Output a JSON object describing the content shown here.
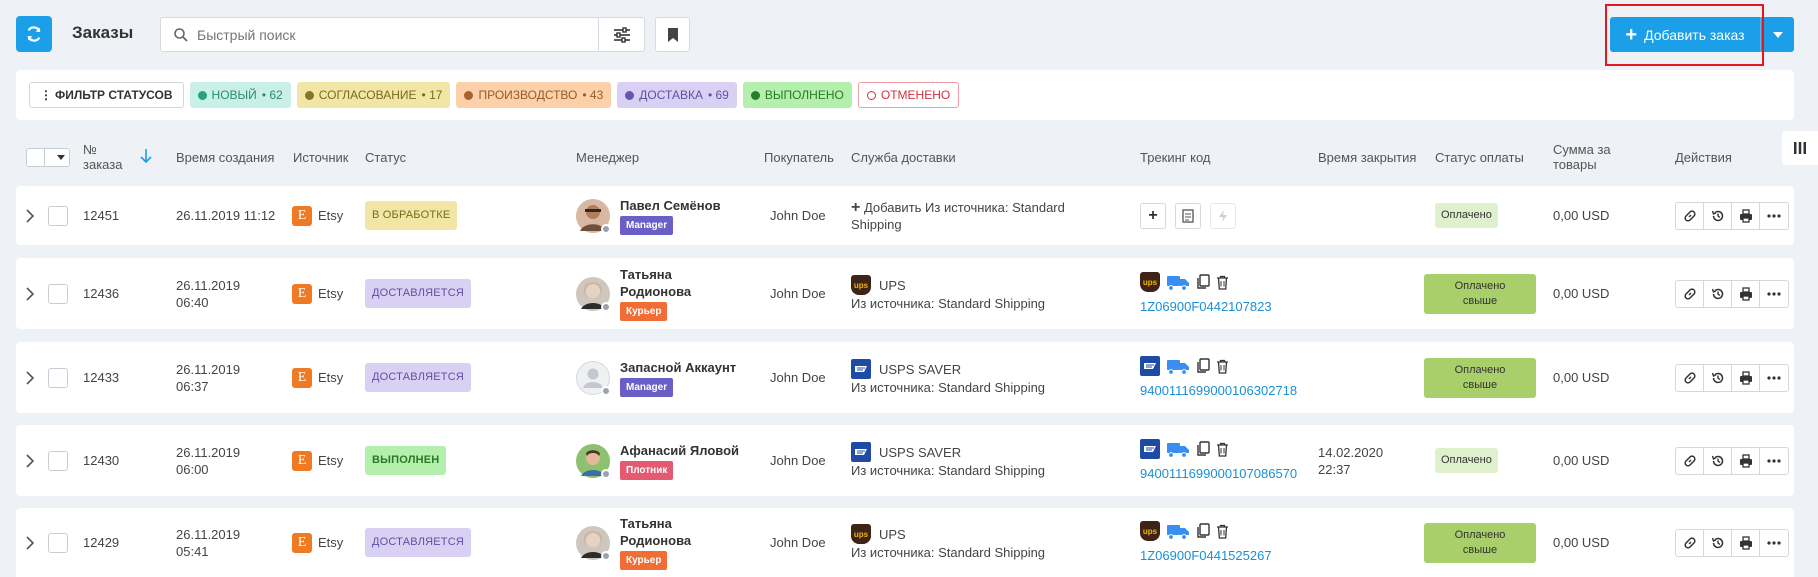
{
  "header": {
    "title": "Заказы",
    "search_placeholder": "Быстрый поиск",
    "add_order_label": "Добавить заказ"
  },
  "status_filters": {
    "filter_label": "ФИЛЬТР СТАТУСОВ",
    "items": [
      {
        "label": "НОВЫЙ",
        "count": "62"
      },
      {
        "label": "СОГЛАСОВАНИЕ",
        "count": "17"
      },
      {
        "label": "ПРОИЗВОДСТВО",
        "count": "43"
      },
      {
        "label": "ДОСТАВКА",
        "count": "69"
      },
      {
        "label": "ВЫПОЛНЕНО",
        "count": ""
      },
      {
        "label": "ОТМЕНЕНО",
        "count": ""
      }
    ]
  },
  "columns": {
    "order_no_1": "№",
    "order_no_2": "заказа",
    "created": "Время создания",
    "source": "Источник",
    "status": "Статус",
    "manager": "Менеджер",
    "buyer": "Покупатель",
    "delivery": "Служба доставки",
    "tracking": "Трекинг код",
    "closed": "Время закрытия",
    "payment": "Статус оплаты",
    "sum_1": "Сумма за",
    "sum_2": "товары",
    "actions": "Действия"
  },
  "rows": [
    {
      "id": "12451",
      "created_1": "26.11.2019 11:12",
      "created_2": "",
      "source": "Etsy",
      "status": "В ОБРАБОТКЕ",
      "manager": "Павел Семёнов",
      "role": "Manager",
      "buyer": "John Doe",
      "delivery_add": "Добавить Из источника: Standard",
      "delivery_add_2": "Shipping",
      "closed_1": "",
      "closed_2": "",
      "payment": "Оплачено",
      "sum": "0,00 USD"
    },
    {
      "id": "12436",
      "created_1": "26.11.2019",
      "created_2": "06:40",
      "source": "Etsy",
      "status": "ДОСТАВЛЯЕТСЯ",
      "manager_1": "Татьяна",
      "manager_2": "Родионова",
      "role": "Курьер",
      "buyer": "John Doe",
      "carrier": "UPS",
      "delivery_src": "Из источника: Standard Shipping",
      "tracking": "1Z06900F0442107823",
      "payment_1": "Оплачено",
      "payment_2": "свыше",
      "sum": "0,00 USD"
    },
    {
      "id": "12433",
      "created_1": "26.11.2019",
      "created_2": "06:37",
      "source": "Etsy",
      "status": "ДОСТАВЛЯЕТСЯ",
      "manager": "Запасной Аккаунт",
      "role": "Manager",
      "buyer": "John Doe",
      "carrier": "USPS SAVER",
      "delivery_src": "Из источника: Standard Shipping",
      "tracking": "9400111699000106302718",
      "payment_1": "Оплачено",
      "payment_2": "свыше",
      "sum": "0,00 USD"
    },
    {
      "id": "12430",
      "created_1": "26.11.2019",
      "created_2": "06:00",
      "source": "Etsy",
      "status": "ВЫПОЛНЕН",
      "manager": "Афанасий Яловой",
      "role": "Плотник",
      "buyer": "John Doe",
      "carrier": "USPS SAVER",
      "delivery_src": "Из источника: Standard Shipping",
      "tracking": "9400111699000107086570",
      "closed_1": "14.02.2020",
      "closed_2": "22:37",
      "payment": "Оплачено",
      "sum": "0,00 USD"
    },
    {
      "id": "12429",
      "created_1": "26.11.2019",
      "created_2": "05:41",
      "source": "Etsy",
      "status": "ДОСТАВЛЯЕТСЯ",
      "manager_1": "Татьяна",
      "manager_2": "Родионова",
      "role": "Курьер",
      "buyer": "John Doe",
      "carrier": "UPS",
      "delivery_src": "Из источника: Standard Shipping",
      "tracking": "1Z06900F0441525267",
      "payment_1": "Оплачено",
      "payment_2": "свыше",
      "sum": "0,00 USD"
    }
  ],
  "colors": {
    "accent": "#1a9fe8",
    "highlight": "#e5161d"
  },
  "icons": {
    "refresh": "refresh-icon",
    "search": "search-icon",
    "filter": "sliders-icon",
    "bookmark": "bookmark-icon",
    "columns": "columns-icon",
    "link": "link-icon",
    "history": "history-icon",
    "print": "print-icon",
    "more": "more-icon"
  }
}
